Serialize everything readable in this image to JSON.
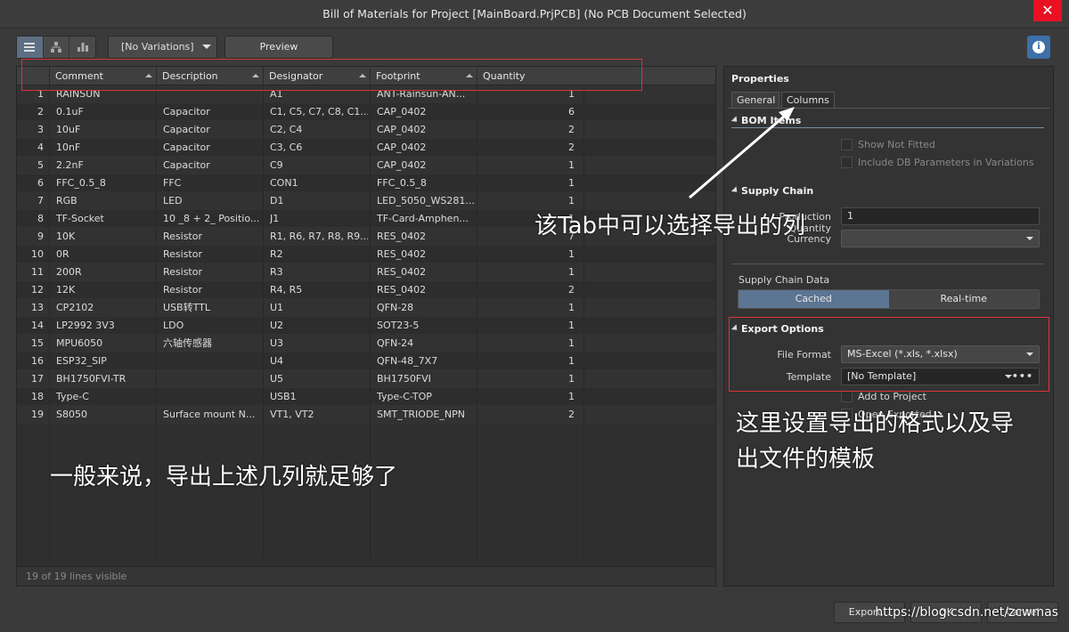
{
  "window": {
    "title": "Bill of Materials for Project [MainBoard.PrjPCB] (No PCB Document Selected)",
    "close_glyph": "✕"
  },
  "toolbar": {
    "variations": "[No Variations]",
    "preview": "Preview"
  },
  "grid": {
    "headers": [
      "Comment",
      "Description",
      "Designator",
      "Footprint",
      "Quantity"
    ],
    "rows": [
      {
        "n": "1",
        "comment": "RAINSUN",
        "description": "",
        "designator": "A1",
        "footprint": "ANT-Rainsun-AN...",
        "qty": "1"
      },
      {
        "n": "2",
        "comment": "0.1uF",
        "description": "Capacitor",
        "designator": "C1, C5, C7, C8, C1...",
        "footprint": "CAP_0402",
        "qty": "6"
      },
      {
        "n": "3",
        "comment": "10uF",
        "description": "Capacitor",
        "designator": "C2, C4",
        "footprint": "CAP_0402",
        "qty": "2"
      },
      {
        "n": "4",
        "comment": "10nF",
        "description": "Capacitor",
        "designator": "C3, C6",
        "footprint": "CAP_0402",
        "qty": "2"
      },
      {
        "n": "5",
        "comment": "2.2nF",
        "description": "Capacitor",
        "designator": "C9",
        "footprint": "CAP_0402",
        "qty": "1"
      },
      {
        "n": "6",
        "comment": "FFC_0.5_8",
        "description": "FFC",
        "designator": "CON1",
        "footprint": "FFC_0.5_8",
        "qty": "1"
      },
      {
        "n": "7",
        "comment": "RGB",
        "description": "LED",
        "designator": "D1",
        "footprint": "LED_5050_WS281...",
        "qty": "1"
      },
      {
        "n": "8",
        "comment": "TF-Socket",
        "description": "10 _8 + 2_ Positio...",
        "designator": "J1",
        "footprint": "TF-Card-Amphen...",
        "qty": "1"
      },
      {
        "n": "9",
        "comment": "10K",
        "description": "Resistor",
        "designator": "R1, R6, R7, R8, R9...",
        "footprint": "RES_0402",
        "qty": "7"
      },
      {
        "n": "10",
        "comment": "0R",
        "description": "Resistor",
        "designator": "R2",
        "footprint": "RES_0402",
        "qty": "1"
      },
      {
        "n": "11",
        "comment": "200R",
        "description": "Resistor",
        "designator": "R3",
        "footprint": "RES_0402",
        "qty": "1"
      },
      {
        "n": "12",
        "comment": "12K",
        "description": "Resistor",
        "designator": "R4, R5",
        "footprint": "RES_0402",
        "qty": "2"
      },
      {
        "n": "13",
        "comment": "CP2102",
        "description": "USB转TTL",
        "designator": "U1",
        "footprint": "QFN-28",
        "qty": "1"
      },
      {
        "n": "14",
        "comment": "LP2992 3V3",
        "description": "LDO",
        "designator": "U2",
        "footprint": "SOT23-5",
        "qty": "1"
      },
      {
        "n": "15",
        "comment": "MPU6050",
        "description": "六轴传感器",
        "designator": "U3",
        "footprint": "QFN-24",
        "qty": "1"
      },
      {
        "n": "16",
        "comment": "ESP32_SIP",
        "description": "",
        "designator": "U4",
        "footprint": "QFN-48_7X7",
        "qty": "1"
      },
      {
        "n": "17",
        "comment": "BH1750FVI-TR",
        "description": "",
        "designator": "U5",
        "footprint": "BH1750FVI",
        "qty": "1"
      },
      {
        "n": "18",
        "comment": "Type-C",
        "description": "",
        "designator": "USB1",
        "footprint": "Type-C-TOP",
        "qty": "1"
      },
      {
        "n": "19",
        "comment": "S8050",
        "description": "Surface mount N...",
        "designator": "VT1, VT2",
        "footprint": "SMT_TRIODE_NPN",
        "qty": "2"
      }
    ],
    "footer": "19 of 19 lines visible"
  },
  "properties": {
    "title": "Properties",
    "tabs": [
      "General",
      "Columns"
    ],
    "bom_items": {
      "heading": "BOM Items",
      "show_not_fitted": "Show Not Fitted",
      "include_db": "Include DB Parameters in Variations"
    },
    "supply_chain": {
      "heading": "Supply Chain",
      "production_qty_label": "Production Quantity",
      "production_qty_value": "1",
      "currency_label": "Currency",
      "data_label": "Supply Chain Data",
      "options": [
        "Cached",
        "Real-time"
      ]
    },
    "export": {
      "heading": "Export Options",
      "file_format_label": "File Format",
      "file_format_value": "MS-Excel (*.xls, *.xlsx)",
      "template_label": "Template",
      "template_value": "[No Template]",
      "add_to_project": "Add to Project",
      "open_exported": "Open Exported"
    }
  },
  "buttons": {
    "export": "Export...",
    "ok": "OK",
    "cancel": "Cancel"
  },
  "annotations": {
    "tab_note": "该Tab中可以选择导出的列",
    "export_note_1": "这里设置导出的格式以及导",
    "export_note_2": "出文件的模板",
    "columns_note": "一般来说，导出上述几列就足够了",
    "watermark": "https://blog.csdn.net/zcwmas"
  },
  "colors": {
    "accent": "#3d6fa8",
    "active_segment": "#5b7592",
    "annotation_box": "#d9333a"
  }
}
